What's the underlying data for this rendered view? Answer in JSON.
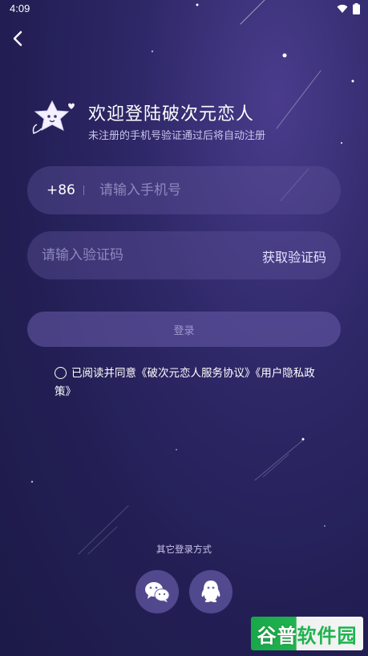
{
  "status_bar": {
    "time": "4:09",
    "icons": [
      "wifi-icon",
      "battery-icon"
    ]
  },
  "header": {
    "back_icon": "chevron-left-icon"
  },
  "welcome": {
    "title": "欢迎登陆破次元恋人",
    "subtitle": "未注册的手机号验证通过后将自动注册",
    "mascot_icon": "star-mascot-icon"
  },
  "phone_field": {
    "country_code": "+86",
    "value": "",
    "placeholder": "请输入手机号"
  },
  "code_field": {
    "value": "",
    "placeholder": "请输入验证码",
    "get_code_label": "获取验证码"
  },
  "login_button": {
    "label": "登录"
  },
  "agreement": {
    "prefix": "已阅读并同意",
    "service_link": "《破次元恋人服务协议》",
    "privacy_link": "《用户隐私政策》",
    "checked": false
  },
  "other_login": {
    "label": "其它登录方式",
    "options": [
      {
        "icon": "wechat-icon"
      },
      {
        "icon": "qq-icon"
      }
    ]
  },
  "watermark": {
    "part1": "谷普",
    "part2": "软件园"
  },
  "colors": {
    "background_top": "#4a3c8c",
    "background_bottom": "#1c1a47",
    "field_bg": "#5a5096",
    "placeholder": "#8d88be"
  }
}
